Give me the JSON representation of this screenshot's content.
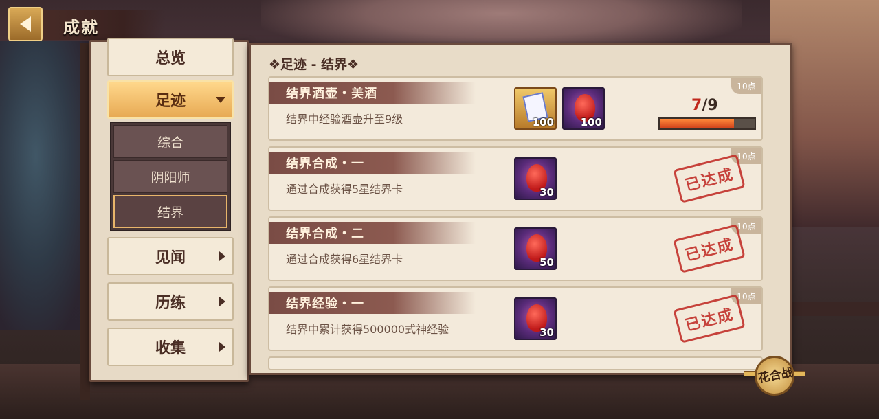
{
  "header": {
    "title": "成就"
  },
  "nav": {
    "items": [
      {
        "label": "总览"
      },
      {
        "label": "足迹"
      },
      {
        "label": "见闻"
      },
      {
        "label": "历练"
      },
      {
        "label": "收集"
      }
    ],
    "subitems": [
      {
        "label": "综合"
      },
      {
        "label": "阴阳师"
      },
      {
        "label": "结界"
      }
    ]
  },
  "section": {
    "title": "❖足迹 - 结界❖"
  },
  "cards": [
    {
      "name": "结界酒壶・美酒",
      "desc": "结界中经验酒壶升至9级",
      "points": "10点",
      "rewards": [
        {
          "icon": "card-item",
          "qty": "100"
        },
        {
          "icon": "gourd-item",
          "qty": "100"
        }
      ],
      "progress": {
        "current": "7",
        "total": "/9",
        "fraction": 0.78
      }
    },
    {
      "name": "结界合成・一",
      "desc": "通过合成获得5星结界卡",
      "points": "10点",
      "rewards": [
        {
          "icon": "gourd-item",
          "qty": "30"
        }
      ],
      "status": "已达成"
    },
    {
      "name": "结界合成・二",
      "desc": "通过合成获得6星结界卡",
      "points": "10点",
      "rewards": [
        {
          "icon": "gourd-item",
          "qty": "50"
        }
      ],
      "status": "已达成"
    },
    {
      "name": "结界经验・一",
      "desc": "结界中累计获得500000式神经验",
      "points": "10点",
      "rewards": [
        {
          "icon": "gourd-item",
          "qty": "30"
        }
      ],
      "status": "已达成"
    }
  ],
  "badge": {
    "label": "花合战"
  },
  "colors": {
    "accent": "#e7a953",
    "stamp": "#c2302a",
    "progress": "#d0401a"
  }
}
